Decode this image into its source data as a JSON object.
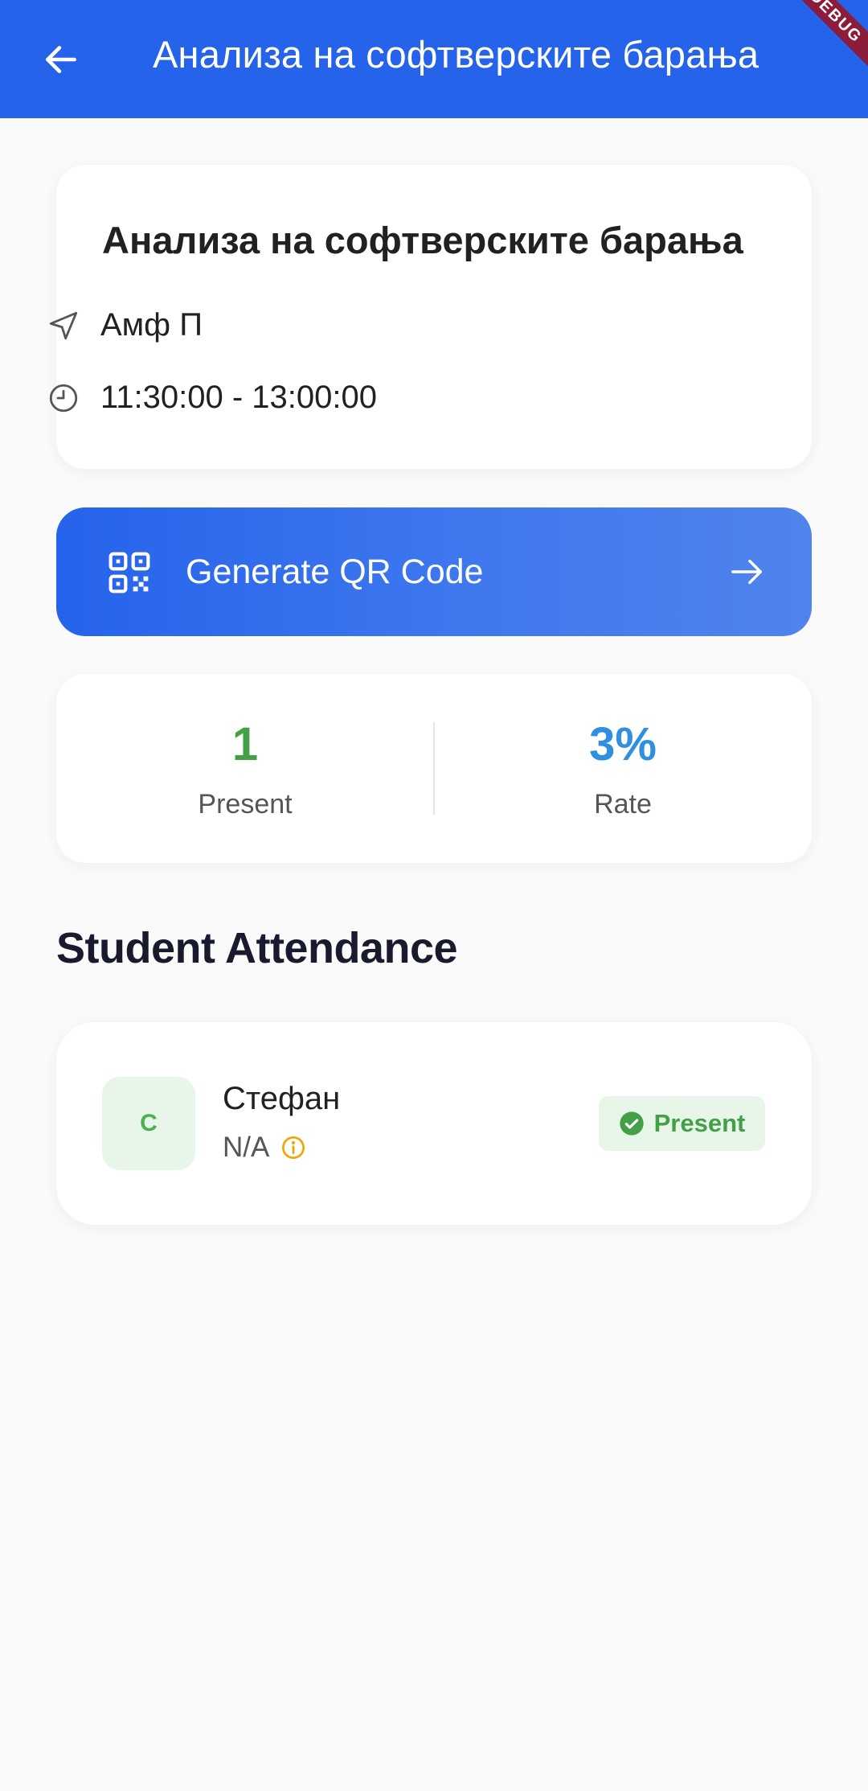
{
  "appbar": {
    "title": "Анализа на софтверските барања",
    "debug_label": "DEBUG",
    "background": "#2563eb"
  },
  "class_info": {
    "title": "Анализа на софтверските барања",
    "location": "Амф П",
    "time": "11:30:00 - 13:00:00",
    "location_icon": "navigation-arrow-icon",
    "time_icon": "clock-icon"
  },
  "qr_button": {
    "label": "Generate QR Code",
    "icon": "qr-code-icon",
    "arrow_icon": "arrow-right-icon"
  },
  "stats": {
    "present_value": "1",
    "present_label": "Present",
    "present_color": "#43a047",
    "rate_value": "3%",
    "rate_label": "Rate",
    "rate_color": "#2f8fe0"
  },
  "attendance": {
    "heading": "Student Attendance",
    "students": [
      {
        "initial": "С",
        "name": "Стефан",
        "index": "N/A",
        "status": "Present",
        "status_color": "#43a047"
      }
    ]
  }
}
